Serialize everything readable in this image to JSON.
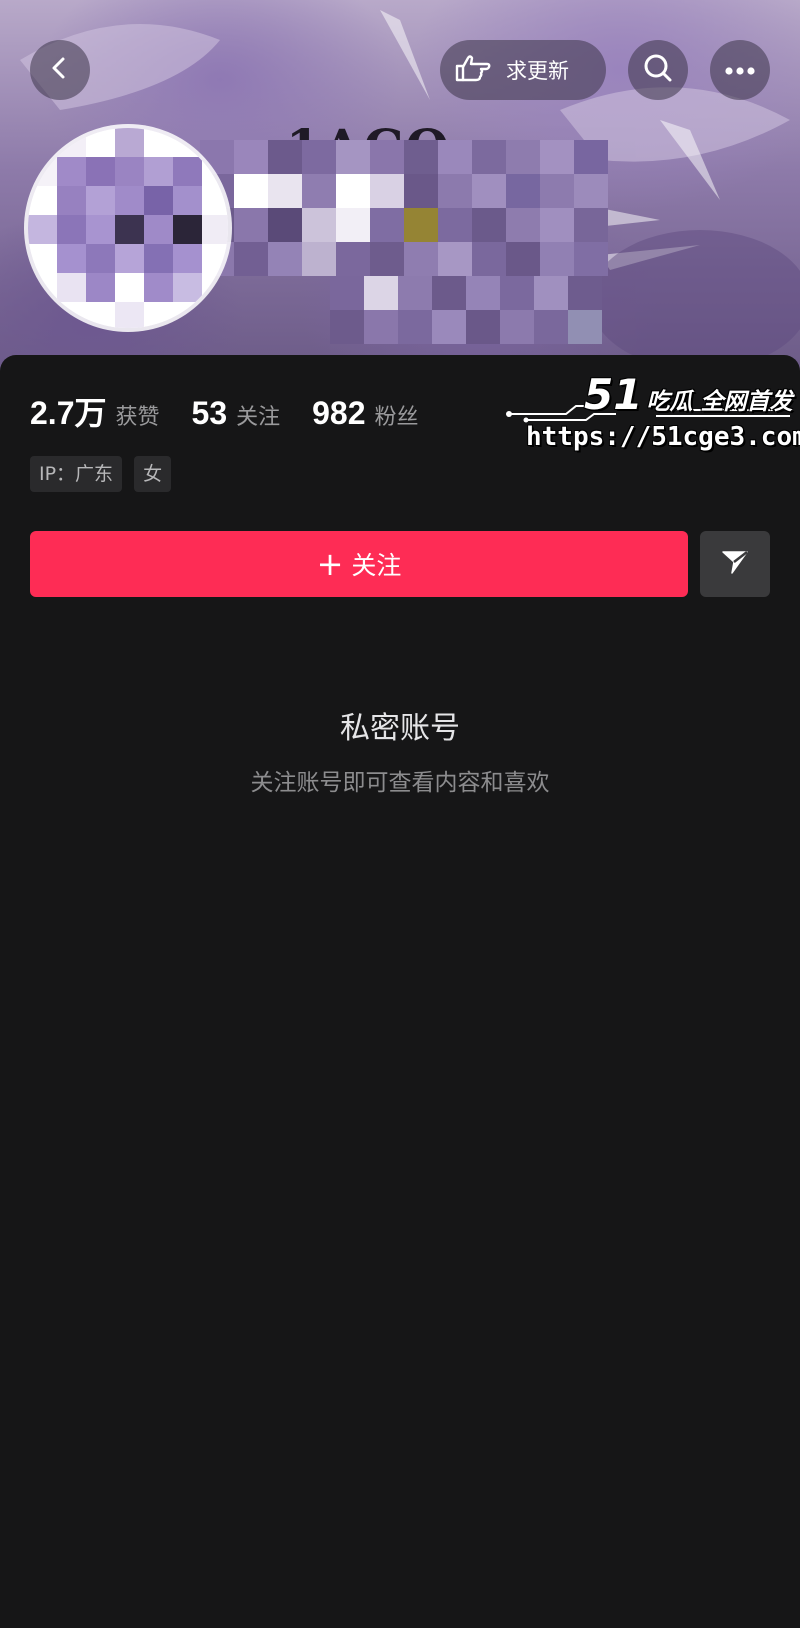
{
  "header": {
    "back_icon": "chevron-left-icon",
    "update_label": "求更新",
    "update_icon": "pointing-hand-icon",
    "search_icon": "search-icon",
    "more_icon": "more-dots-icon"
  },
  "banner": {
    "text": "1ACO"
  },
  "stats": [
    {
      "value": "2.7万",
      "label": "获赞"
    },
    {
      "value": "53",
      "label": "关注"
    },
    {
      "value": "982",
      "label": "粉丝"
    }
  ],
  "tags": [
    {
      "label": "IP：广东"
    },
    {
      "label": "女"
    }
  ],
  "actions": {
    "follow_icon": "plus-icon",
    "follow_plus": "+",
    "follow_label": "关注",
    "share_icon": "share-arrow-icon"
  },
  "private": {
    "title": "私密账号",
    "subtitle": "关注账号即可查看内容和喜欢"
  },
  "watermark": {
    "brand_number": "51",
    "brand_text": "吃瓜 全网首发",
    "url": "https://51cge3.com"
  },
  "colors": {
    "background": "#161617",
    "follow": "#fe2c55",
    "share_bg": "#3a3a3c",
    "tag_bg": "#2a2a2c",
    "muted_text": "#9a9a9c"
  }
}
